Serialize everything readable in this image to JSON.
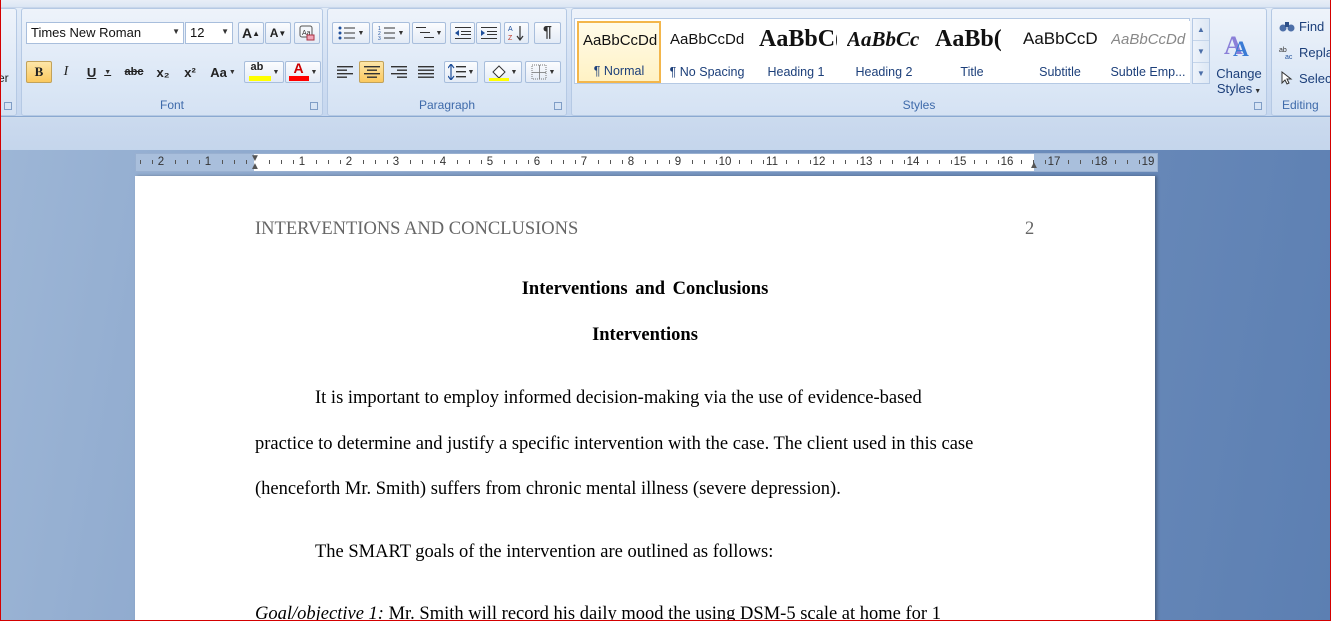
{
  "ribbon": {
    "partial_left_label": "er",
    "font": {
      "group_label": "Font",
      "font_name": "Times New Roman",
      "font_size": "12",
      "grow_label": "A",
      "shrink_label": "A",
      "bold": "B",
      "italic": "I",
      "underline": "U",
      "strikethrough": "abc",
      "subscript": "x₂",
      "superscript": "x²",
      "change_case": "Aa",
      "highlight": "ab",
      "font_color": "A"
    },
    "paragraph": {
      "group_label": "Paragraph",
      "pilcrow": "¶"
    },
    "styles": {
      "group_label": "Styles",
      "items": [
        {
          "sample": "AaBbCcDd",
          "name": "¶ Normal"
        },
        {
          "sample": "AaBbCcDd",
          "name": "¶ No Spacing"
        },
        {
          "sample": "AaBbC(",
          "name": "Heading 1"
        },
        {
          "sample": "AaBbCc",
          "name": "Heading 2"
        },
        {
          "sample": "AaBb(",
          "name": "Title"
        },
        {
          "sample": "AaBbCcD",
          "name": "Subtitle"
        },
        {
          "sample": "AaBbCcDd",
          "name": "Subtle Emp..."
        }
      ],
      "change_styles_line1": "Change",
      "change_styles_line2": "Styles"
    },
    "editing": {
      "group_label": "Editing",
      "find": "Find",
      "replace": "Repla",
      "select": "Selec"
    }
  },
  "ruler": {
    "left_numbers": [
      "2",
      "1"
    ],
    "right_numbers": [
      "1",
      "2",
      "3",
      "4",
      "5",
      "6",
      "7",
      "8",
      "9",
      "10",
      "11",
      "12",
      "13",
      "14",
      "15",
      "16",
      "17",
      "18",
      "19"
    ]
  },
  "document": {
    "running_head": "INTERVENTIONS AND CONCLUSIONS",
    "page_number": "2",
    "title": "Interventions and Conclusions",
    "subtitle": "Interventions",
    "p1_line1": "It is important to employ informed decision-making via the use of evidence-based",
    "p1_line2": "practice to determine and justify a specific intervention with the case. The client used in this case",
    "p1_line3": "(henceforth Mr. Smith) suffers from chronic mental illness (severe depression).",
    "p2_line1": "The SMART goals of the intervention are outlined as follows:",
    "goal_label": "Goal/objective 1:",
    "goal_text": " Mr. Smith will record his daily mood the using DSM-5 scale at home for 1"
  },
  "colors": {
    "ribbon_text": "#15428b",
    "selected_style_border": "#f3b64b",
    "highlight_yellow": "#ffff00",
    "font_color_red": "#ff0000",
    "workspace_blue": "#5c7fb2"
  }
}
